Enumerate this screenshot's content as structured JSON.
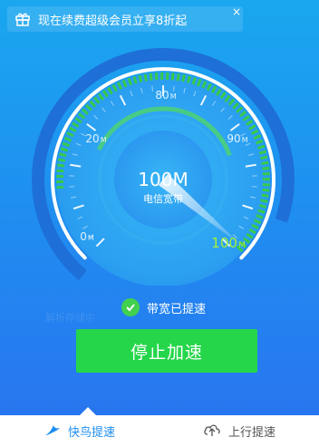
{
  "promo": {
    "text": "现在续费超级会员立享8折起"
  },
  "close_label": "×",
  "gauge": {
    "speed_value": "100M",
    "speed_label": "电信宽带",
    "scale": [
      {
        "num": "0",
        "unit": "M",
        "active": false
      },
      {
        "num": "20",
        "unit": "M",
        "active": false
      },
      {
        "num": "80",
        "unit": "M",
        "active": false
      },
      {
        "num": "90",
        "unit": "M",
        "active": false
      },
      {
        "num": "100",
        "unit": "M",
        "active": true
      }
    ],
    "level_fraction": 1.0,
    "colors": {
      "track": "#1e6fd8",
      "ring": "#ffffff",
      "accent": "#38c94a",
      "active_label": "#a6f038"
    }
  },
  "status": {
    "text": "带宽已提速"
  },
  "ghost_text": "解析存储中",
  "button": {
    "label": "停止加速"
  },
  "tabs": [
    {
      "label": "快鸟提速",
      "active": true,
      "icon": "bird-icon"
    },
    {
      "label": "上行提速",
      "active": false,
      "icon": "cloud-upload-icon"
    }
  ]
}
